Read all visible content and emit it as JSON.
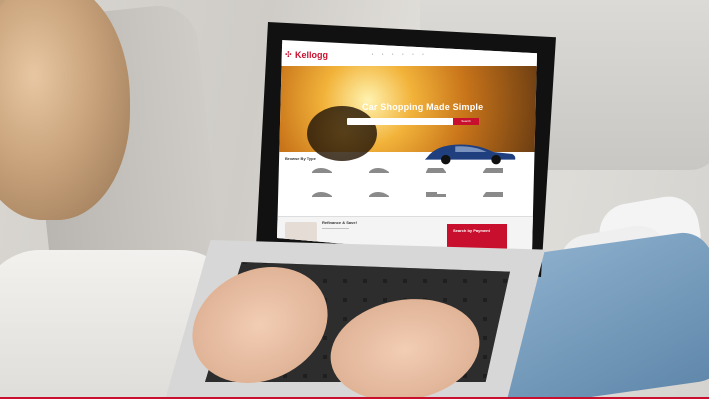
{
  "screen": {
    "brand": "Kellogg",
    "hero_title": "Car Shopping Made Simple",
    "search_button": "Search",
    "section_title": "Browse By Type",
    "bottom_left_title": "Refinance & Save!",
    "bottom_right_title": "Search by Payment",
    "icons": [
      "logo-icon"
    ],
    "colors": {
      "brand_red": "#c8102e",
      "link_blue": "#2b64a8"
    }
  }
}
